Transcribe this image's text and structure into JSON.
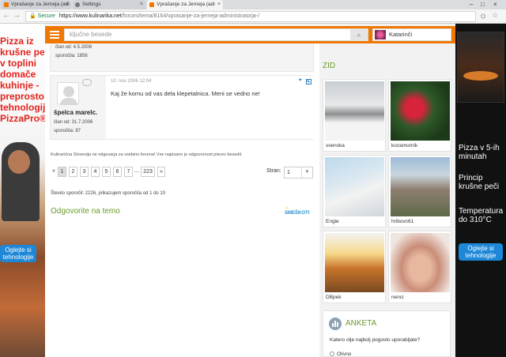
{
  "browser": {
    "tabs": [
      {
        "label": "Vprašanje za Jerneja (adi"
      },
      {
        "label": "Settings"
      },
      {
        "label": "Vprašanje za Jerneja (adi"
      }
    ],
    "secure_label": "Secure",
    "url_host": "https://www.kulinarika.net",
    "url_path": "/forumi/tema/8164/vprasanje-za-jerneja-administratorja-/"
  },
  "ad_left": {
    "text": "Pizza iz krušne peči v toplini domače kuhinje - preprosto s tehnologijo PizzaPro®",
    "cta": "Oglejte si tehnologije"
  },
  "ad_right": {
    "line1": "Pizza v 5-ih minutah",
    "line2": "Princip krušne peči",
    "line3": "Temperatura do 310°C",
    "cta": "Oglejte si tehnologije"
  },
  "header": {
    "search_placeholder": "ključne besede",
    "user_name": "Katarinči"
  },
  "prev_post": {
    "joined": "član od: 4.5.2006",
    "posts": "sporočila: 1856"
  },
  "post": {
    "username": "špelca marelc.",
    "joined": "član od: 31.7.2006",
    "posts": "sporočila: 87",
    "date": "10. nov 2006 12:04",
    "text": "Kaj že komu od vas dela klepetalnica. Meni se vedno ne!"
  },
  "disclaimer": "Kulinarična Slovenija ne odgovarja za vsebino foruma! Vse napisano je odgovornost piscev besedil.",
  "pager": {
    "prev": "«",
    "pages": [
      "1",
      "2",
      "3",
      "4",
      "5",
      "6",
      "7"
    ],
    "ellipsis": "...",
    "last": "223",
    "next": "»",
    "current": "1",
    "stran_label": "Stran:",
    "stran_value": "1"
  },
  "count_text": "Število sporočil: 2226, prikazujem sporočila od 1 do 10",
  "reply_label": "Odgovorite na temo",
  "smiley_label": "SMEŠKOTI",
  "zid": {
    "title": "ZID",
    "tiles": [
      {
        "name": "svenska"
      },
      {
        "name": "kozamurnik"
      },
      {
        "name": "Engie"
      },
      {
        "name": "hribovc61"
      },
      {
        "name": "DBpek"
      },
      {
        "name": "nenci"
      }
    ]
  },
  "anketa": {
    "title": "ANKETA",
    "question": "Katero olje najbolj pogosto uporabljate?",
    "option1": "Olivno"
  },
  "colors": {
    "brand_orange": "#f07800",
    "accent_green": "#6a9a2a"
  }
}
